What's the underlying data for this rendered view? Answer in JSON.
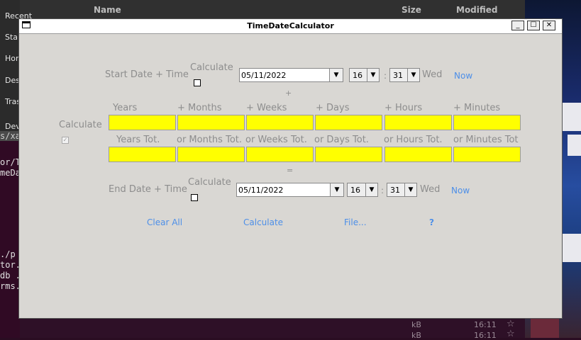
{
  "background": {
    "sidebar_items": [
      "Recent",
      "Star",
      "Hor",
      "Des",
      "Tras",
      "Dev"
    ],
    "path_fragment": "s/xa",
    "file_columns": {
      "name": "Name",
      "size": "Size",
      "modified": "Modified"
    },
    "terminal_lines": [
      "or/T",
      "meDa",
      "./p",
      "tor.",
      "db .",
      "rms."
    ],
    "bottom_files": [
      {
        "size": "kB",
        "time": "16:11"
      },
      {
        "size": "kB",
        "time": "16:11"
      }
    ]
  },
  "window": {
    "title": "TimeDateCalculator"
  },
  "start": {
    "label": "Start Date + Time",
    "calc_label": "Calculate",
    "date": "05/11/2022",
    "hour": "16",
    "minute": "31",
    "colon": ":",
    "weekday": "Wed",
    "now": "Now"
  },
  "plus_sign": "+",
  "units": {
    "calc_label": "Calculate",
    "labels": [
      "Years",
      "+ Months",
      "+ Weeks",
      "+ Days",
      "+ Hours",
      "+ Minutes"
    ],
    "totals_labels": [
      "Years Tot.",
      "or Months Tot.",
      "or Weeks Tot.",
      "or Days Tot.",
      "or Hours Tot.",
      "or Minutes Tot"
    ],
    "values": [
      "",
      "",
      "",
      "",
      "",
      ""
    ],
    "totals_values": [
      "",
      "",
      "",
      "",
      "",
      ""
    ],
    "field_color": "#ffff00"
  },
  "equals_sign": "=",
  "end": {
    "label": "End Date + Time",
    "calc_label": "Calculate",
    "date": "05/11/2022",
    "hour": "16",
    "minute": "31",
    "colon": ":",
    "weekday": "Wed",
    "now": "Now"
  },
  "actions": {
    "clear_all": "Clear All",
    "calculate": "Calculate",
    "file": "File...",
    "help": "?"
  },
  "colors": {
    "link": "#4d8fe8",
    "label": "#8d8d8d",
    "window_bg": "#d9d7d3"
  }
}
